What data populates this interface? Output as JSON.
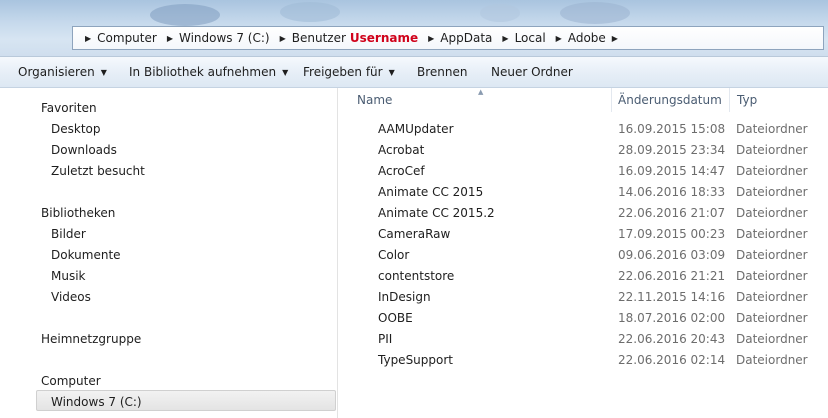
{
  "address_bar": {
    "crumbs": [
      {
        "label": "Computer"
      },
      {
        "label": "Windows 7 (C:)"
      },
      {
        "label": "Benutzer"
      },
      {
        "label": "Username",
        "highlight": true
      },
      {
        "label": "AppData"
      },
      {
        "label": "Local"
      },
      {
        "label": "Adobe"
      }
    ]
  },
  "toolbar": {
    "organize": "Organisieren",
    "include_library": "In Bibliothek aufnehmen",
    "share_with": "Freigeben für",
    "burn": "Brennen",
    "new_folder": "Neuer Ordner"
  },
  "nav": {
    "favorites_header": "Favoriten",
    "favorites": [
      "Desktop",
      "Downloads",
      "Zuletzt besucht"
    ],
    "libraries_header": "Bibliotheken",
    "libraries": [
      "Bilder",
      "Dokumente",
      "Musik",
      "Videos"
    ],
    "homegroup": "Heimnetzgruppe",
    "computer_header": "Computer",
    "computer_items": [
      "Windows 7 (C:)"
    ]
  },
  "list": {
    "columns": {
      "name": "Name",
      "date": "Änderungsdatum",
      "type": "Typ"
    },
    "rows": [
      {
        "name": "AAMUpdater",
        "date": "16.09.2015 15:08",
        "type": "Dateiordner"
      },
      {
        "name": "Acrobat",
        "date": "28.09.2015 23:34",
        "type": "Dateiordner"
      },
      {
        "name": "AcroCef",
        "date": "16.09.2015 14:47",
        "type": "Dateiordner"
      },
      {
        "name": "Animate CC 2015",
        "date": "14.06.2016 18:33",
        "type": "Dateiordner"
      },
      {
        "name": "Animate CC 2015.2",
        "date": "22.06.2016 21:07",
        "type": "Dateiordner"
      },
      {
        "name": "CameraRaw",
        "date": "17.09.2015 00:23",
        "type": "Dateiordner"
      },
      {
        "name": "Color",
        "date": "09.06.2016 03:09",
        "type": "Dateiordner"
      },
      {
        "name": "contentstore",
        "date": "22.06.2016 21:21",
        "type": "Dateiordner"
      },
      {
        "name": "InDesign",
        "date": "22.11.2015 14:16",
        "type": "Dateiordner"
      },
      {
        "name": "OOBE",
        "date": "18.07.2016 02:00",
        "type": "Dateiordner"
      },
      {
        "name": "PII",
        "date": "22.06.2016 20:43",
        "type": "Dateiordner"
      },
      {
        "name": "TypeSupport",
        "date": "22.06.2016 02:14",
        "type": "Dateiordner"
      }
    ]
  },
  "colors": {
    "highlight_crumb": "#d0021b",
    "toolbar_bg": "#e6eef7"
  }
}
